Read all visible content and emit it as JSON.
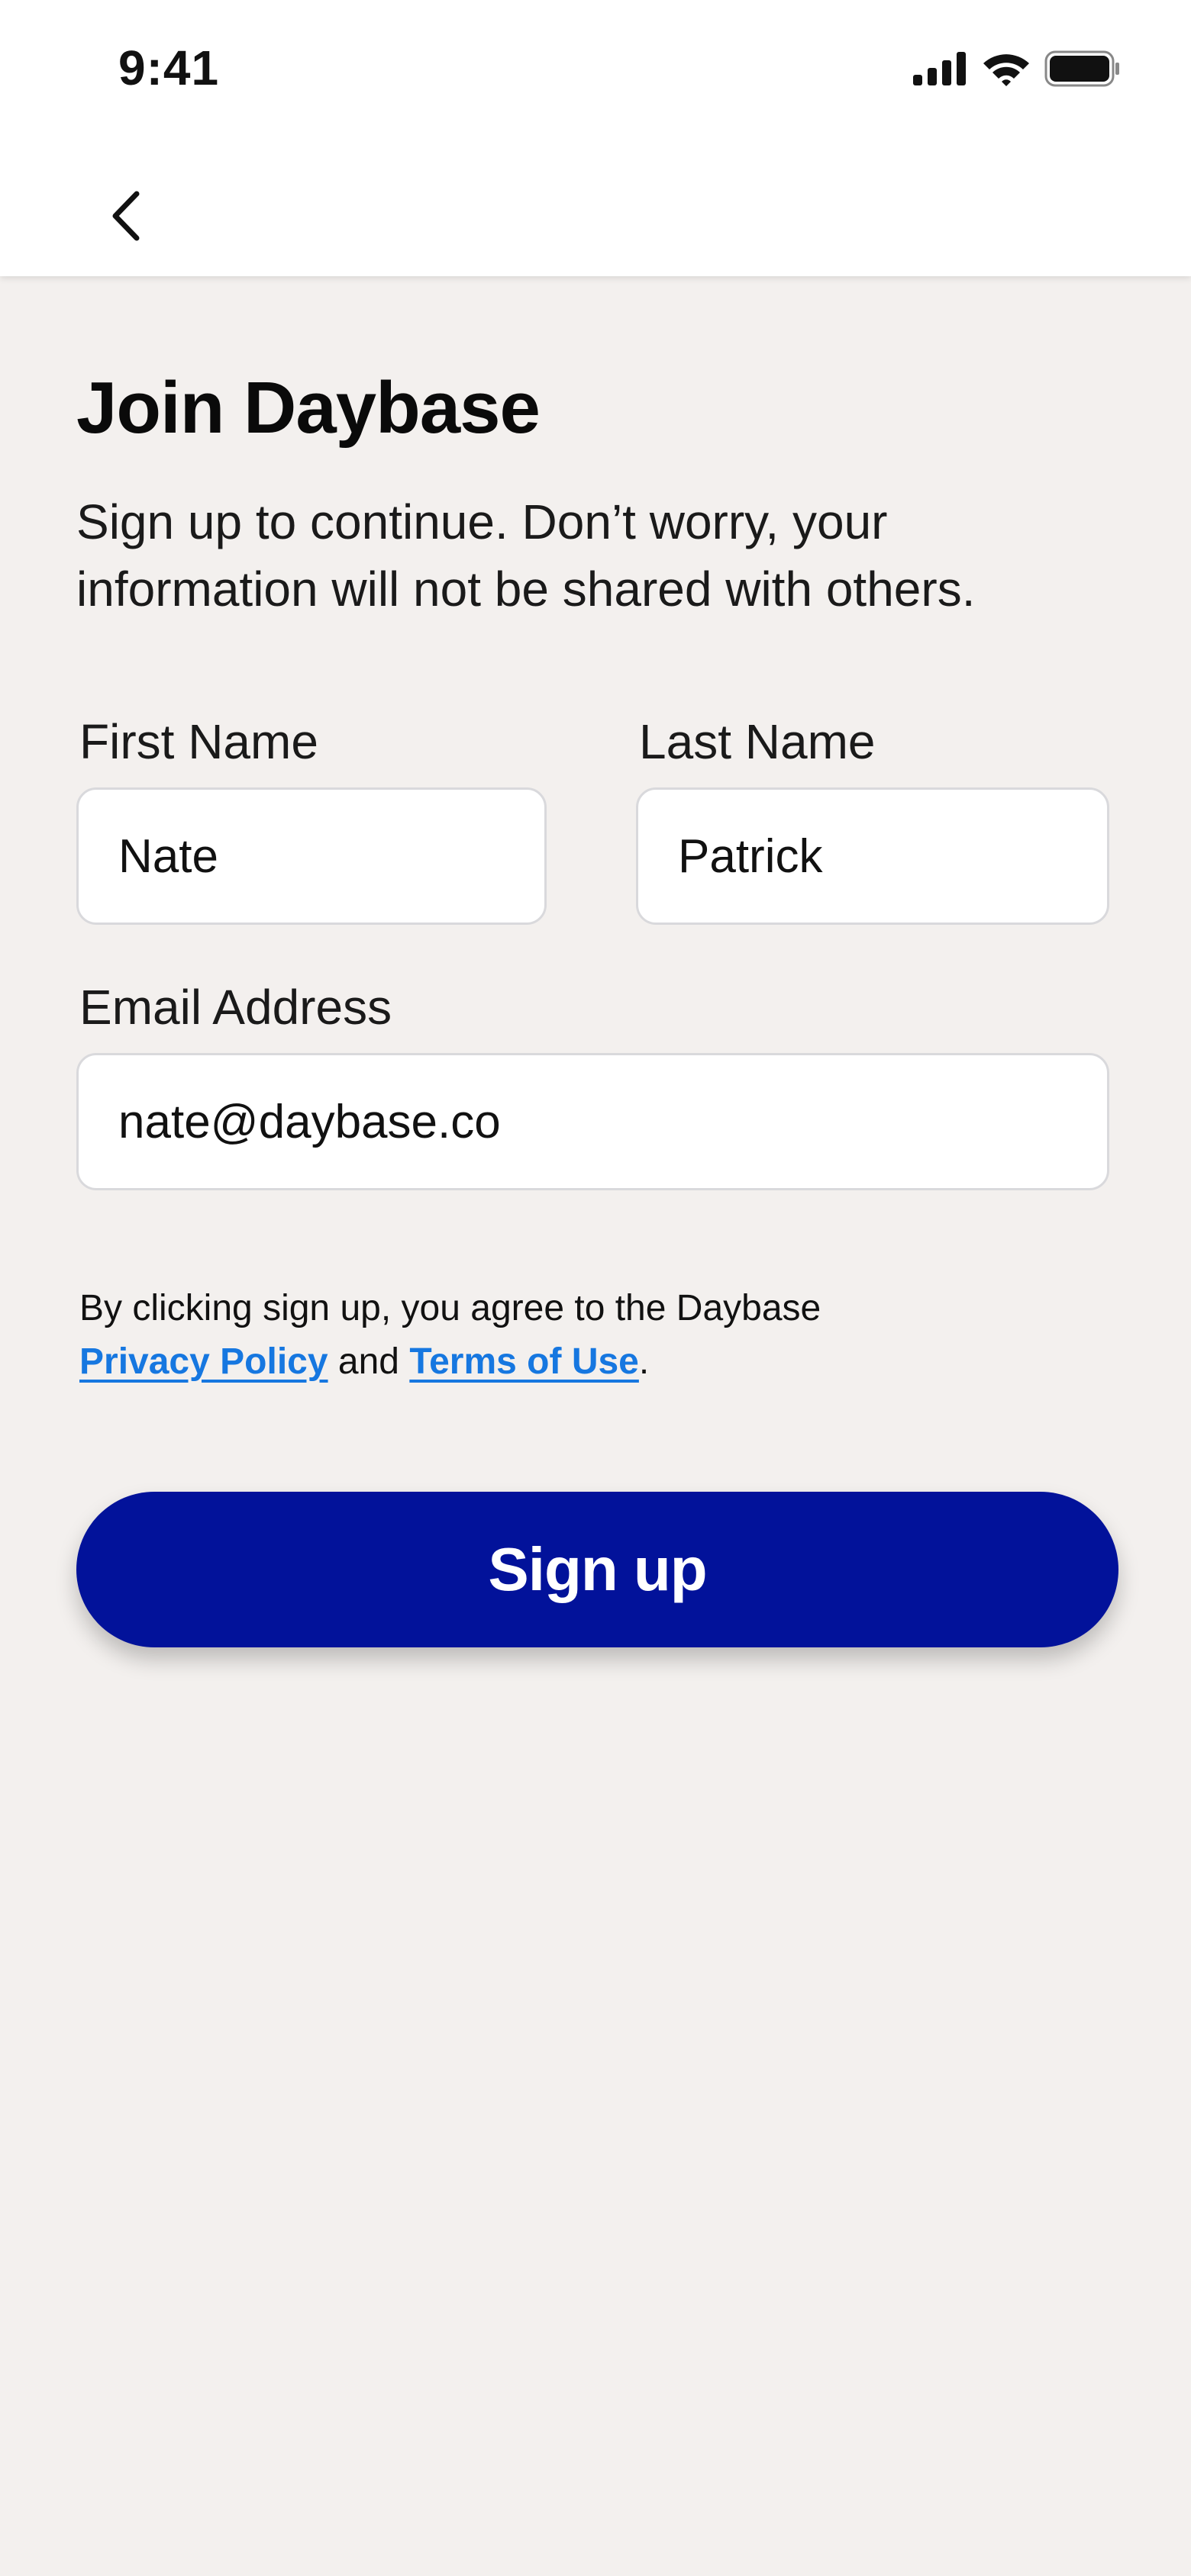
{
  "status_bar": {
    "time": "9:41",
    "icons": [
      "cellular-signal-icon",
      "wifi-icon",
      "battery-icon"
    ]
  },
  "nav": {
    "back_icon": "chevron-left-icon"
  },
  "page": {
    "title": "Join Daybase",
    "subtitle": "Sign up to continue. Don’t worry, your information will not be shared with others."
  },
  "form": {
    "first_name": {
      "label": "First Name",
      "value": "Nate"
    },
    "last_name": {
      "label": "Last Name",
      "value": "Patrick"
    },
    "email": {
      "label": "Email Address",
      "value": "nate@daybase.co"
    }
  },
  "terms": {
    "prefix": "By clicking sign up, you agree to the Daybase",
    "privacy_link": "Privacy Policy",
    "conjunction": "and",
    "terms_link": "Terms of Use",
    "suffix": "."
  },
  "signup_button": {
    "label": "Sign up"
  },
  "colors": {
    "background": "#F3F0EE",
    "primary_button": "#02129A",
    "link": "#1677E0"
  }
}
